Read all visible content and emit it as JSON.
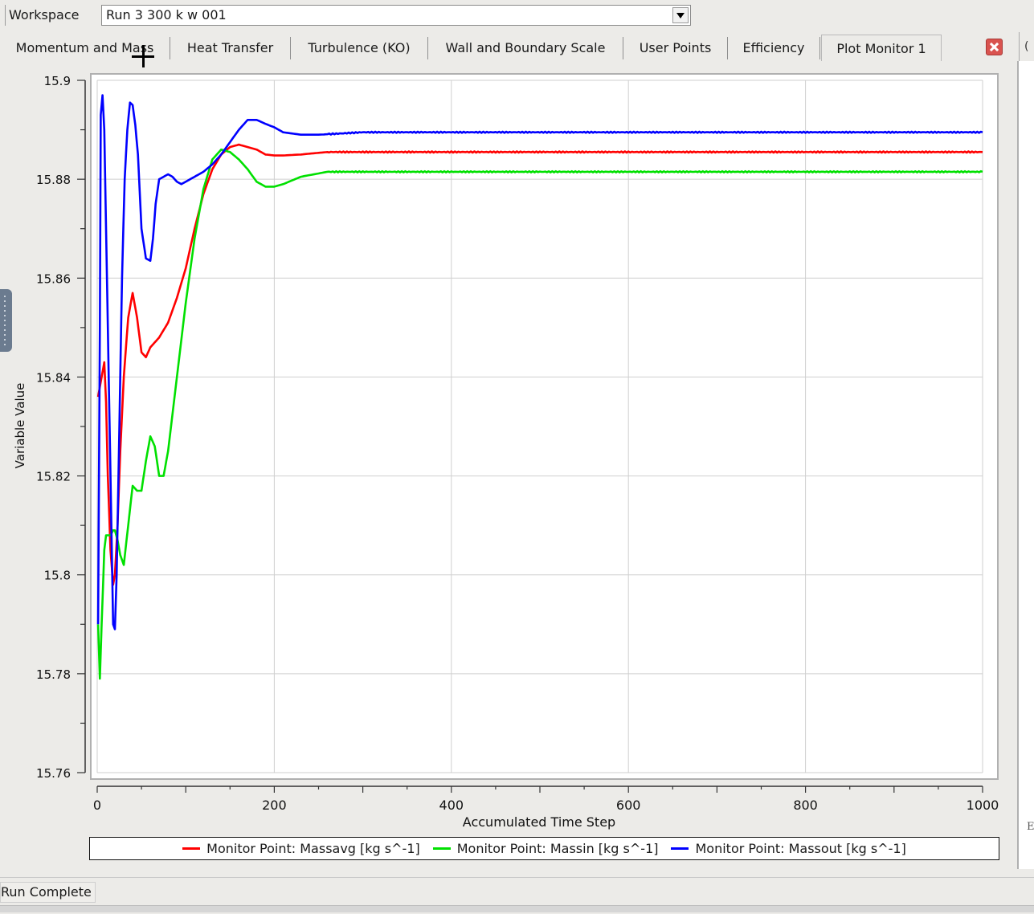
{
  "workspace": {
    "label": "Workspace",
    "selected_run": "Run 3 300 k w 001"
  },
  "tabs": [
    {
      "label": "Momentum and Mass",
      "active": false
    },
    {
      "label": "Heat Transfer",
      "active": false
    },
    {
      "label": "Turbulence (KO)",
      "active": false
    },
    {
      "label": "Wall and Boundary Scale",
      "active": false
    },
    {
      "label": "User Points",
      "active": false
    },
    {
      "label": "Efficiency",
      "active": false
    },
    {
      "label": "Plot Monitor 1",
      "active": true
    }
  ],
  "tab_extra": "(",
  "right_panel_letter": "E",
  "status": {
    "text": "Run Complete"
  },
  "colors": {
    "massavg": "#ff0000",
    "massin": "#00e000",
    "massout": "#0000ff",
    "grid": "#cfcfcf"
  },
  "icons": {
    "close_tab": "close-icon",
    "dropdown": "chevron-down-icon"
  },
  "chart_data": {
    "type": "line",
    "xlabel": "Accumulated Time Step",
    "ylabel": "Variable Value",
    "xlim": [
      0,
      1000
    ],
    "ylim": [
      15.76,
      15.9
    ],
    "xticks": [
      0,
      200,
      400,
      600,
      800,
      1000
    ],
    "yticks": [
      15.76,
      15.78,
      15.8,
      15.82,
      15.84,
      15.86,
      15.88,
      15.9
    ],
    "ytick_labels": [
      "15.76",
      "15.78",
      "15.8",
      "15.82",
      "15.84",
      "15.86",
      "15.88",
      "15.9"
    ],
    "grid": true,
    "legend_position": "bottom",
    "series": [
      {
        "name": "Monitor Point: Massavg [kg s^-1]",
        "color": "#ff0000",
        "x": [
          1,
          3,
          5,
          8,
          10,
          12,
          15,
          18,
          20,
          23,
          26,
          30,
          35,
          40,
          45,
          50,
          55,
          60,
          65,
          70,
          80,
          90,
          100,
          110,
          120,
          130,
          140,
          150,
          160,
          170,
          180,
          190,
          200,
          210,
          230,
          260,
          300,
          400,
          500,
          600,
          700,
          800,
          900,
          1000
        ],
        "y": [
          15.836,
          15.838,
          15.84,
          15.843,
          15.835,
          15.82,
          15.805,
          15.798,
          15.8,
          15.81,
          15.825,
          15.84,
          15.852,
          15.857,
          15.852,
          15.845,
          15.844,
          15.846,
          15.847,
          15.848,
          15.851,
          15.856,
          15.862,
          15.87,
          15.877,
          15.882,
          15.885,
          15.8865,
          15.887,
          15.8865,
          15.886,
          15.885,
          15.8848,
          15.8848,
          15.885,
          15.8855,
          15.8855,
          15.8855,
          15.8855,
          15.8855,
          15.8855,
          15.8855,
          15.8855,
          15.8855
        ]
      },
      {
        "name": "Monitor Point: Massin [kg s^-1]",
        "color": "#00e000",
        "x": [
          1,
          3,
          5,
          8,
          10,
          12,
          15,
          18,
          20,
          23,
          26,
          30,
          35,
          40,
          45,
          50,
          55,
          60,
          65,
          70,
          75,
          80,
          90,
          100,
          110,
          120,
          130,
          140,
          150,
          160,
          170,
          180,
          190,
          200,
          210,
          230,
          260,
          300,
          400,
          500,
          600,
          700,
          800,
          900,
          1000
        ],
        "y": [
          15.79,
          15.779,
          15.79,
          15.805,
          15.808,
          15.808,
          15.808,
          15.809,
          15.809,
          15.807,
          15.804,
          15.802,
          15.81,
          15.818,
          15.817,
          15.817,
          15.823,
          15.828,
          15.826,
          15.82,
          15.82,
          15.825,
          15.84,
          15.855,
          15.868,
          15.878,
          15.884,
          15.886,
          15.8855,
          15.884,
          15.882,
          15.8795,
          15.8785,
          15.8785,
          15.879,
          15.8805,
          15.8815,
          15.8815,
          15.8815,
          15.8815,
          15.8815,
          15.8815,
          15.8815,
          15.8815,
          15.8815
        ]
      },
      {
        "name": "Monitor Point: Massout [kg s^-1]",
        "color": "#0000ff",
        "x": [
          1,
          3,
          4,
          6,
          8,
          10,
          13,
          16,
          18,
          20,
          22,
          25,
          28,
          31,
          34,
          37,
          40,
          43,
          46,
          50,
          55,
          60,
          63,
          66,
          70,
          75,
          80,
          85,
          90,
          95,
          100,
          110,
          120,
          130,
          140,
          150,
          160,
          170,
          180,
          190,
          200,
          210,
          230,
          250,
          300,
          400,
          500,
          600,
          700,
          800,
          900,
          1000
        ],
        "y": [
          15.79,
          15.85,
          15.893,
          15.897,
          15.89,
          15.87,
          15.84,
          15.81,
          15.79,
          15.789,
          15.8,
          15.83,
          15.86,
          15.88,
          15.89,
          15.8955,
          15.895,
          15.891,
          15.885,
          15.87,
          15.864,
          15.8635,
          15.868,
          15.875,
          15.88,
          15.8805,
          15.881,
          15.8805,
          15.8795,
          15.879,
          15.8795,
          15.8805,
          15.8815,
          15.883,
          15.885,
          15.8875,
          15.89,
          15.892,
          15.892,
          15.8912,
          15.8905,
          15.8895,
          15.889,
          15.889,
          15.8895,
          15.8895,
          15.8895,
          15.8895,
          15.8895,
          15.8895,
          15.8895,
          15.8895
        ]
      }
    ]
  }
}
